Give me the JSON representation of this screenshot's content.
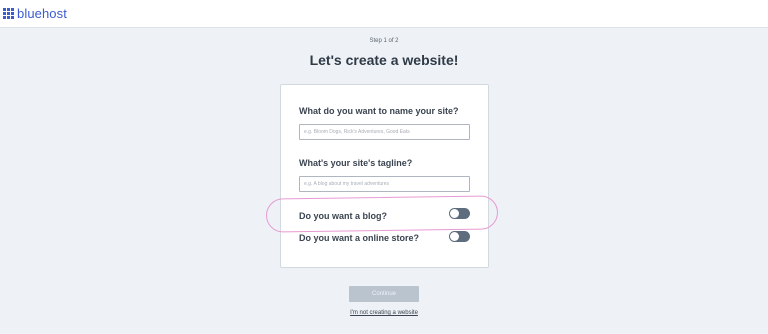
{
  "header": {
    "logo_text": "bluehost",
    "logo_icon": "grid-icon",
    "brand_color": "#3b5ccf"
  },
  "step_text": "Step 1 of 2",
  "title": "Let's create a website!",
  "form": {
    "site_name_label": "What do you want to name your site?",
    "site_name_placeholder": "e.g. Bloom Dogs, Rick's Adventures, Good Eats",
    "site_name_value": "",
    "tagline_label": "What's your site's tagline?",
    "tagline_placeholder": "e.g. A blog about my travel adventures",
    "tagline_value": "",
    "blog_label": "Do you want a blog?",
    "blog_enabled": false,
    "store_label": "Do you want a online store?",
    "store_enabled": false
  },
  "continue_label": "Continue",
  "skip_link": "I'm not creating a website",
  "colors": {
    "highlight": "#e89ad2",
    "toggle_off": "#5d6d7d",
    "button_disabled": "#b9c4cf"
  }
}
